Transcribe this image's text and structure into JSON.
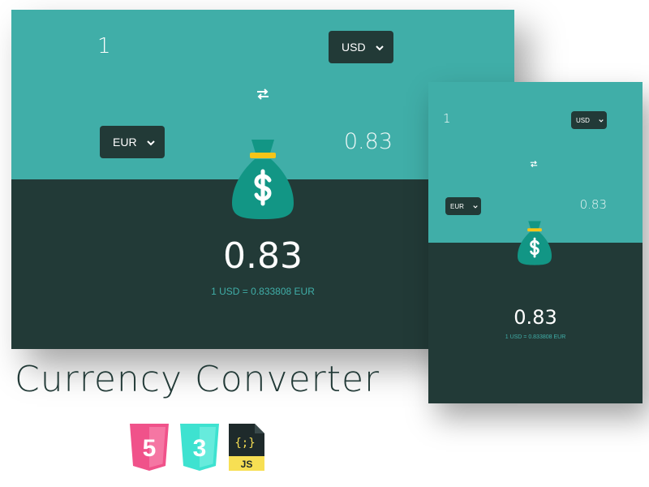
{
  "desktop": {
    "amount_value": "1",
    "from_currency": "USD",
    "to_currency": "EUR",
    "result_light": "0.83",
    "result_big": "0.83",
    "rate_text": "1 USD = 0.833808 EUR",
    "swap_glyph": "⇄"
  },
  "mobile": {
    "amount_value": "1",
    "from_currency": "USD",
    "to_currency": "EUR",
    "result_light": "0.83",
    "result_big": "0.83",
    "rate_text": "1 USD = 0.833808 EUR",
    "swap_glyph": "⇄"
  },
  "title": "Currency Converter",
  "tech_badges": {
    "html": "5",
    "css": "3",
    "js_braces": "{;}",
    "js_label": "JS"
  },
  "icons": [
    "money-bag-icon",
    "swap-icon",
    "chevron-down-icon",
    "html5-icon",
    "css3-icon",
    "js-icon"
  ],
  "colors": {
    "teal": "#40aea8",
    "dark": "#223a37",
    "bag": "#129685",
    "bag_band": "#f5c518",
    "html5": "#f0528a",
    "css3": "#3ee2d0",
    "js_dark": "#1e2a2b",
    "js_yellow": "#f7df53"
  }
}
